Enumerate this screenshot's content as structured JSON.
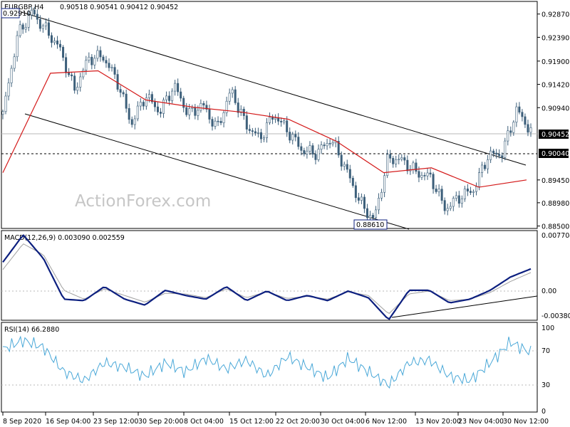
{
  "header": {
    "symbol": "EURGBP,H4",
    "ohlc": "0.90518 0.90541 0.90412 0.90452"
  },
  "watermark": "ActionForex.com",
  "labels": {
    "high_marker": "0.92910",
    "low_marker": "0.88610",
    "current_price": "0.90452",
    "support_level": "0.90040"
  },
  "macd": {
    "title": "MACD(12,26,9) 0.003090 0.002559",
    "ticks": [
      "0.007704",
      "0.00",
      "-0.003804"
    ]
  },
  "rsi": {
    "title": "RSI(14) 66.2880",
    "ticks": [
      "100",
      "70",
      "30",
      "0"
    ]
  },
  "colors": {
    "candles": "#3c5f7a",
    "ma_line": "#d41a1a",
    "macd_line": "#0c1f7f",
    "signal_line": "#a0a0a0",
    "rsi_line": "#4aa8d8",
    "price_box": "#000000"
  },
  "chart_data": [
    {
      "type": "candlestick",
      "title": "EURGBP,H4",
      "y_ticks": [
        "0.92870",
        "0.92390",
        "0.91900",
        "0.91420",
        "0.90940",
        "0.90452",
        "0.90040",
        "0.89450",
        "0.88980",
        "0.88500"
      ],
      "x_tick_labels": [
        "8 Sep 2020",
        "16 Sep 04:00",
        "23 Sep 12:00",
        "30 Sep 20:00",
        "8 Oct 04:00",
        "15 Oct 12:00",
        "22 Oct 20:00",
        "30 Oct 04:00",
        "6 Nov 12:00",
        "13 Nov 20:00",
        "23 Nov 04:00",
        "30 Nov 12:00"
      ],
      "ylim": [
        0.8845,
        0.9313
      ],
      "key_levels": {
        "high": 0.9291,
        "low": 0.8861,
        "current": 0.90452,
        "horizontal_support": 0.9004
      },
      "close_path": [
        {
          "x": "8 Sep 2020",
          "y": 0.908
        },
        {
          "x": "9 Sep 2020",
          "y": 0.924
        },
        {
          "x": "10 Sep 2020",
          "y": 0.9291
        },
        {
          "x": "11 Sep 2020",
          "y": 0.9255
        },
        {
          "x": "14 Sep 2020",
          "y": 0.9215
        },
        {
          "x": "16 Sep 04:00",
          "y": 0.913
        },
        {
          "x": "18 Sep 2020",
          "y": 0.9195
        },
        {
          "x": "21 Sep 2020",
          "y": 0.92
        },
        {
          "x": "23 Sep 12:00",
          "y": 0.915
        },
        {
          "x": "25 Sep 2020",
          "y": 0.906
        },
        {
          "x": "28 Sep 2020",
          "y": 0.912
        },
        {
          "x": "30 Sep 20:00",
          "y": 0.9085
        },
        {
          "x": "2 Oct 2020",
          "y": 0.914
        },
        {
          "x": "6 Oct 2020",
          "y": 0.908
        },
        {
          "x": "8 Oct 04:00",
          "y": 0.91
        },
        {
          "x": "12 Oct 2020",
          "y": 0.905
        },
        {
          "x": "15 Oct 12:00",
          "y": 0.913
        },
        {
          "x": "16 Oct 2020",
          "y": 0.906
        },
        {
          "x": "20 Oct 2020",
          "y": 0.903
        },
        {
          "x": "22 Oct 20:00",
          "y": 0.908
        },
        {
          "x": "26 Oct 2020",
          "y": 0.9045
        },
        {
          "x": "28 Oct 2020",
          "y": 0.9005
        },
        {
          "x": "30 Oct 04:00",
          "y": 0.9
        },
        {
          "x": "3 Nov 2020",
          "y": 0.903
        },
        {
          "x": "5 Nov 2020",
          "y": 0.897
        },
        {
          "x": "6 Nov 12:00",
          "y": 0.89
        },
        {
          "x": "9 Nov 2020",
          "y": 0.8861
        },
        {
          "x": "10 Nov 2020",
          "y": 0.899
        },
        {
          "x": "12 Nov 2020",
          "y": 0.8985
        },
        {
          "x": "13 Nov 20:00",
          "y": 0.896
        },
        {
          "x": "17 Nov 2020",
          "y": 0.895
        },
        {
          "x": "20 Nov 2020",
          "y": 0.8885
        },
        {
          "x": "23 Nov 04:00",
          "y": 0.891
        },
        {
          "x": "26 Nov 2020",
          "y": 0.8925
        },
        {
          "x": "27 Nov 2020",
          "y": 0.8995
        },
        {
          "x": "30 Nov 12:00",
          "y": 0.9
        },
        {
          "x": "1 Dec 2020",
          "y": 0.909
        },
        {
          "x": "2 Dec 2020",
          "y": 0.90452
        }
      ],
      "moving_average": {
        "name": "MA",
        "color": "red",
        "points": [
          {
            "x": "8 Sep 2020",
            "y": 0.896
          },
          {
            "x": "16 Sep 04:00",
            "y": 0.9165
          },
          {
            "x": "23 Sep 12:00",
            "y": 0.917
          },
          {
            "x": "30 Sep 20:00",
            "y": 0.911
          },
          {
            "x": "8 Oct 04:00",
            "y": 0.9095
          },
          {
            "x": "15 Oct 12:00",
            "y": 0.9085
          },
          {
            "x": "22 Oct 20:00",
            "y": 0.907
          },
          {
            "x": "30 Oct 04:00",
            "y": 0.9025
          },
          {
            "x": "6 Nov 12:00",
            "y": 0.896
          },
          {
            "x": "13 Nov 20:00",
            "y": 0.897
          },
          {
            "x": "23 Nov 04:00",
            "y": 0.893
          },
          {
            "x": "30 Nov 12:00",
            "y": 0.8945
          }
        ]
      },
      "channel": {
        "upper": [
          {
            "x": "9 Sep 2020",
            "y": 0.9291
          },
          {
            "x": "30 Nov 12:00",
            "y": 0.8985
          }
        ],
        "lower": [
          {
            "x": "9 Sep 2020",
            "y": 0.9088
          },
          {
            "x": "9 Nov 2020",
            "y": 0.8853
          }
        ]
      }
    },
    {
      "type": "line",
      "title": "MACD(12,26,9) 0.003090 0.002559",
      "ylim": [
        -0.0038,
        0.0077
      ],
      "series": [
        {
          "name": "MACD",
          "values": [
            0.004,
            0.0077,
            0.0045,
            -0.001,
            -0.0012,
            0.0007,
            -0.001,
            -0.0018,
            0.0002,
            -0.0005,
            -0.001,
            0.0007,
            -0.0012,
            0.0001,
            -0.0012,
            -0.0005,
            -0.0012,
            0.0001,
            -0.0008,
            -0.0038,
            0.0002,
            0.0002,
            -0.0015,
            -0.001,
            0.0002,
            0.002,
            0.0031
          ]
        },
        {
          "name": "Signal",
          "values": [
            0.003,
            0.0065,
            0.005,
            0.0002,
            -0.001,
            0.0004,
            -0.0005,
            -0.0014,
            -0.0002,
            -0.0003,
            -0.0008,
            0.0004,
            -0.0008,
            0.0,
            -0.0009,
            -0.0006,
            -0.001,
            0.0,
            -0.0005,
            -0.003,
            -0.0003,
            0.0001,
            -0.0012,
            -0.001,
            -0.0001,
            0.0014,
            0.0026
          ]
        }
      ]
    },
    {
      "type": "line",
      "title": "RSI(14) 66.2880",
      "ylim": [
        0,
        100
      ],
      "series": [
        {
          "name": "RSI",
          "values": [
            70,
            80,
            72,
            45,
            35,
            55,
            50,
            40,
            55,
            45,
            60,
            48,
            58,
            40,
            62,
            50,
            38,
            60,
            45,
            30,
            55,
            58,
            40,
            35,
            55,
            78,
            66.288
          ]
        }
      ]
    }
  ]
}
